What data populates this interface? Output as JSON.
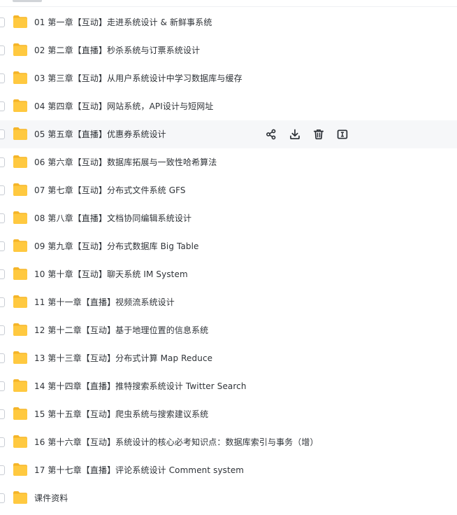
{
  "file_list": {
    "items": [
      {
        "name": "01 第一章【互动】走进系统设计 & 新鲜事系统"
      },
      {
        "name": "02 第二章【直播】秒杀系统与订票系统设计"
      },
      {
        "name": "03 第三章【互动】从用户系统设计中学习数据库与缓存"
      },
      {
        "name": "04 第四章【互动】网站系统，API设计与短网址"
      },
      {
        "name": "05 第五章【直播】优惠券系统设计"
      },
      {
        "name": "06 第六章【互动】数据库拓展与一致性哈希算法"
      },
      {
        "name": "07 第七章【互动】分布式文件系统 GFS"
      },
      {
        "name": "08 第八章【直播】文档协同编辑系统设计"
      },
      {
        "name": "09 第九章【互动】分布式数据库 Big Table"
      },
      {
        "name": "10 第十章【互动】聊天系统 IM System"
      },
      {
        "name": "11 第十一章【直播】视频流系统设计"
      },
      {
        "name": "12 第十二章【互动】基于地理位置的信息系统"
      },
      {
        "name": "13 第十三章【互动】分布式计算 Map Reduce"
      },
      {
        "name": "14 第十四章【直播】推特搜索系统设计 Twitter Search"
      },
      {
        "name": "15 第十五章【互动】爬虫系统与搜索建议系统"
      },
      {
        "name": "16 第十六章【互动】系统设计的核心必考知识点：数据库索引与事务（增）"
      },
      {
        "name": "17 第十七章【直播】评论系统设计  Comment system"
      },
      {
        "name": "课件资料"
      }
    ],
    "hovered_index": 4
  },
  "row_actions": {
    "icons": [
      "share-icon",
      "download-icon",
      "delete-icon",
      "rename-icon"
    ]
  },
  "colors": {
    "folder_body": "#FFC940",
    "folder_back": "#F5B529",
    "icon": "#2b2f36",
    "text": "#2f3338",
    "hover_bg": "#f6f7f9"
  }
}
